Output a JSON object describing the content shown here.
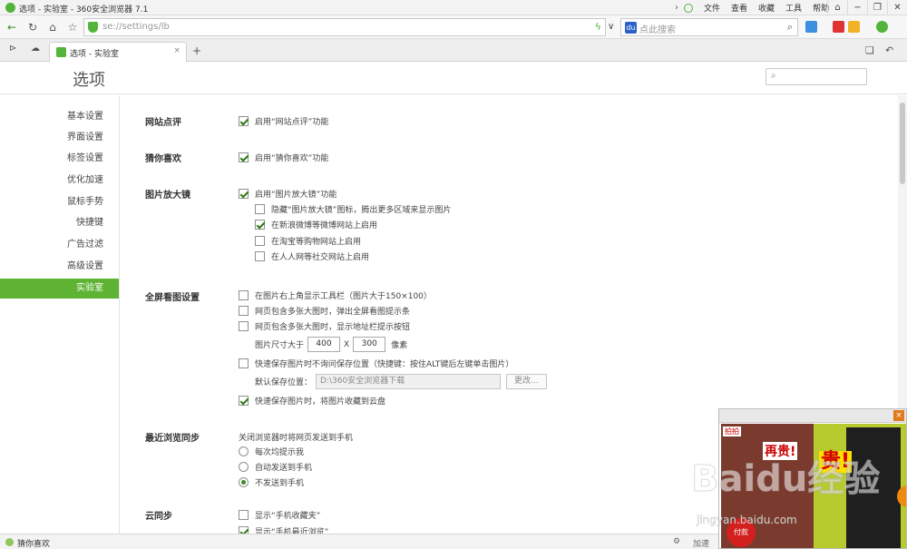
{
  "window": {
    "title": "选项 - 实验室 - 360安全浏览器 7.1",
    "menu": [
      "文件",
      "查看",
      "收藏",
      "工具",
      "帮助"
    ],
    "controls": [
      "⌂",
      "−",
      "❐",
      "✕"
    ]
  },
  "navbar": {
    "url": "se://settings/lb",
    "search_placeholder": "点此搜索"
  },
  "tabs": [
    {
      "label": "选项 - 实验室"
    }
  ],
  "page": {
    "title": "选项",
    "search_placeholder": ""
  },
  "sidebar": {
    "items": [
      "基本设置",
      "界面设置",
      "标签设置",
      "优化加速",
      "鼠标手势",
      "快捷键",
      "广告过滤",
      "高级设置",
      "实验室"
    ],
    "active_index": 8
  },
  "sections": {
    "site_review": {
      "title": "网站点评",
      "option": "启用“网站点评”功能",
      "checked": true
    },
    "guess": {
      "title": "猜你喜欢",
      "option": "启用“猜你喜欢”功能",
      "checked": true
    },
    "magnifier": {
      "title": "图片放大镜",
      "option": "启用“图片放大镜”功能",
      "checked": true,
      "sub": [
        {
          "label": "隐藏“图片放大镜”图标，腾出更多区域来显示图片",
          "checked": false
        },
        {
          "label": "在新浪微博等微博网站上启用",
          "checked": true
        },
        {
          "label": "在淘宝等购物网站上启用",
          "checked": false
        },
        {
          "label": "在人人网等社交网站上启用",
          "checked": false
        }
      ]
    },
    "fullscreen": {
      "title": "全屏看图设置",
      "options": [
        {
          "label": "在图片右上角显示工具栏（图片大于150×100）",
          "checked": false
        },
        {
          "label": "网页包含多张大图时，弹出全屏看图提示条",
          "checked": false
        },
        {
          "label": "网页包含多张大图时，显示地址栏提示按钮",
          "checked": false
        }
      ],
      "size_label": "图片尺寸大于",
      "width": "400",
      "x_sep": "X",
      "height": "300",
      "unit": "像素",
      "quick_save": {
        "label": "快速保存图片时不询问保存位置（快捷键：按住ALT键后左键单击图片）",
        "checked": false
      },
      "save_path_label": "默认保存位置：",
      "save_path": "D:\\360安全浏览器下载",
      "change_button": "更改...",
      "cloud_save": {
        "label": "快速保存图片时，将图片收藏到云盘",
        "checked": true
      }
    },
    "recent_sync": {
      "title": "最近浏览同步",
      "description": "关闭浏览器时将网页发送到手机",
      "options": [
        {
          "label": "每次均提示我",
          "checked": false
        },
        {
          "label": "自动发送到手机",
          "checked": false
        },
        {
          "label": "不发送到手机",
          "checked": true
        }
      ]
    },
    "cloud_sync": {
      "title": "云同步",
      "options": [
        {
          "label": "显示“手机收藏夹”",
          "checked": false
        },
        {
          "label": "显示“手机最近浏览”",
          "checked": true
        }
      ]
    }
  },
  "statusbar": {
    "text": "猜你喜欢",
    "right_text": "加速"
  },
  "ad": {
    "tag": "拍拍",
    "headline1": "再贵!",
    "headline2": "贵!",
    "badge": "付款"
  },
  "watermark": {
    "text": "Baidu经验",
    "url": "jingyan.baidu.com"
  },
  "colors": {
    "accent": "#5fb333",
    "brand": "#52b43a"
  }
}
